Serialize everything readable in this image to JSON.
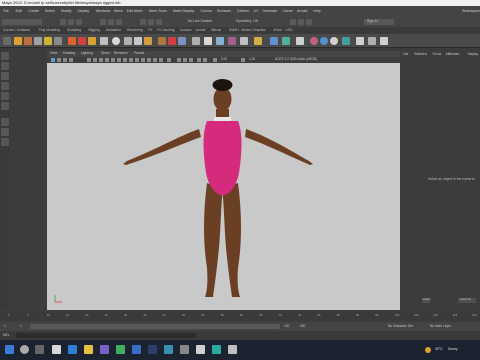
{
  "window": {
    "title": "Maya 2022: D:\\model tp sell\\currently\\dd file\\maya\\maya rigged.mb"
  },
  "menu": [
    "File",
    "Edit",
    "Create",
    "Select",
    "Modify",
    "Display",
    "Windows",
    "Mesh",
    "Edit Mesh",
    "Mesh Tools",
    "Mesh Display",
    "Curves",
    "Surfaces",
    "Deform",
    "UV",
    "Generate",
    "Cache",
    "Arnold",
    "Help"
  ],
  "workspace": "Workspace",
  "toolbar": {
    "surface": "No Live Surface",
    "symmetry": "Symmetry: Off",
    "signin": "Sign In"
  },
  "shelf_tabs": [
    "Curves / Surfaces",
    "Poly Modeling",
    "Sculpting",
    "Rigging",
    "Animation",
    "Rendering",
    "FX",
    "FX Caching",
    "Custom",
    "Arnold",
    "Bifrost",
    "MASH",
    "Motion Graphics",
    "XGen",
    "USD"
  ],
  "viewport": {
    "menu": [
      "View",
      "Shading",
      "Lighting",
      "Show",
      "Renderer",
      "Panels"
    ],
    "colorspace": "ACES 1.0 SDR-video (sRGB)",
    "cam_field1": "0.00",
    "cam_field2": "1.00"
  },
  "figure": {
    "suit_color": "#d62a7c",
    "skin_color": "#6b3f24"
  },
  "channel_box": {
    "tabs": [
      "Channels",
      "Edit",
      "Object",
      "Show"
    ],
    "side_tabs": [
      "List",
      "Selected",
      "Focus",
      "Attributes",
      "Display"
    ],
    "message": "Select an object in the scene to"
  },
  "timeline": {
    "ticks": [
      "1",
      "5",
      "10",
      "15",
      "20",
      "25",
      "30",
      "35",
      "40",
      "45",
      "50",
      "55",
      "60",
      "65",
      "70",
      "75",
      "80",
      "85",
      "90",
      "95",
      "100",
      "105",
      "110",
      "115",
      "120"
    ],
    "current": "1"
  },
  "range": {
    "start": "1",
    "inner_start": "1",
    "inner_end": "120",
    "end": "120",
    "end2": "200",
    "character_set": "No Character Set",
    "anim_layer": "No Anim Layer",
    "fps": "24 fps"
  },
  "cmdline": {
    "label": "MEL"
  },
  "panel_buttons": {
    "attach": "Attach",
    "attach_all": "Attach All"
  },
  "taskbar": {
    "temp": "30°C",
    "weather": "Sunny",
    "app_label": "Maya"
  }
}
